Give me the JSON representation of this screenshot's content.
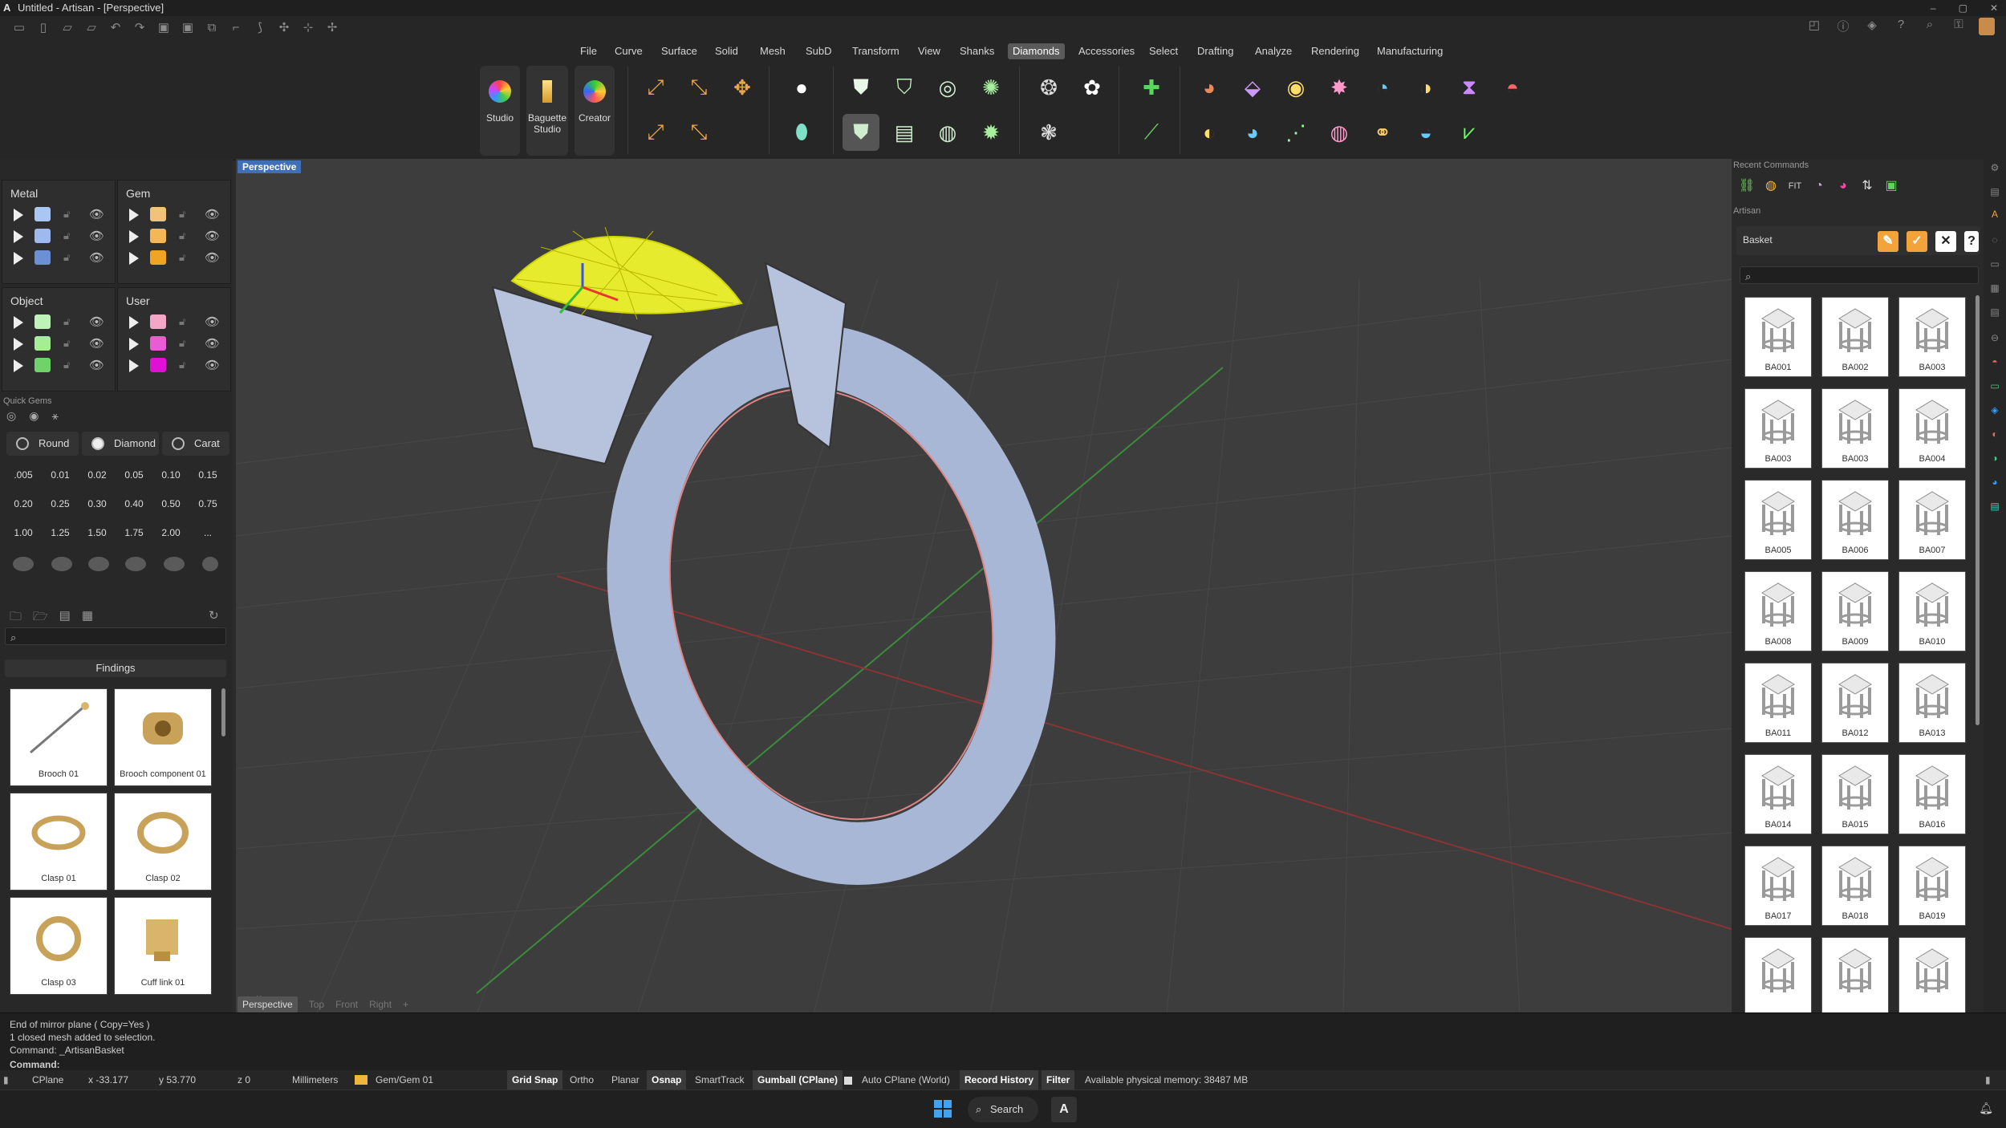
{
  "window": {
    "title": "Untitled - Artisan - [Perspective]",
    "logo": "A",
    "controls": [
      "–",
      "▢",
      "✕"
    ]
  },
  "quick_access": {
    "icons": [
      "new-icon",
      "open-icon",
      "open-icon",
      "open-icon",
      "undo-icon",
      "redo-icon",
      "save-icon",
      "save-as-icon",
      "settings-icon",
      "sketch-icon",
      "polyline-icon",
      "point-icon",
      "dimension-icon",
      "snap-icon"
    ],
    "right_icons": [
      "notification-icon",
      "info-icon",
      "layers-icon",
      "help-icon",
      "search-icon",
      "key-icon"
    ]
  },
  "menu": [
    "File",
    "Curve",
    "Surface",
    "Solid",
    "Mesh",
    "SubD",
    "Transform",
    "View",
    "Shanks",
    "Diamonds",
    "Accessories",
    "Select",
    "Drafting",
    "Analyze",
    "Rendering",
    "Manufacturing"
  ],
  "menu_active": "Diamonds",
  "ribbon": {
    "studio": "Studio",
    "baguette_studio": "Baguette Studio",
    "creator": "Creator"
  },
  "layers": {
    "metal": {
      "title": "Metal",
      "colors": [
        "#a9c7f2",
        "#9eb9ee",
        "#6c8fd6"
      ]
    },
    "gem": {
      "title": "Gem",
      "colors": [
        "#f2c27a",
        "#f3b855",
        "#f0a424"
      ]
    },
    "object": {
      "title": "Object",
      "colors": [
        "#bff2b9",
        "#a6ee94",
        "#6fd36a"
      ]
    },
    "user": {
      "title": "User",
      "colors": [
        "#f3a6c6",
        "#ea5bd4",
        "#e010d4"
      ]
    }
  },
  "quick_gems": {
    "title": "Quick Gems",
    "shape": "Round",
    "material": "Diamond",
    "unit": "Carat",
    "sizes": [
      ".005",
      "0.01",
      "0.02",
      "0.05",
      "0.10",
      "0.15",
      "0.20",
      "0.25",
      "0.30",
      "0.40",
      "0.50",
      "0.75",
      "1.00",
      "1.25",
      "1.50",
      "1.75",
      "2.00",
      "..."
    ]
  },
  "findings": {
    "search_placeholder": "",
    "category": "Findings",
    "items": [
      {
        "label": "Brooch 01",
        "icon": "brooch-pin-icon"
      },
      {
        "label": "Brooch component 01",
        "icon": "brooch-component-icon"
      },
      {
        "label": "Clasp 01",
        "icon": "clasp-icon"
      },
      {
        "label": "Clasp 02",
        "icon": "clasp-icon"
      },
      {
        "label": "Clasp 03",
        "icon": "clasp-icon"
      },
      {
        "label": "Cuff link 01",
        "icon": "cuff-link-icon"
      }
    ]
  },
  "viewport": {
    "active": "Perspective",
    "tabs": [
      "Perspective",
      "Top",
      "Front",
      "Right"
    ],
    "add": "+",
    "axis_y": "y",
    "axis_x": "x"
  },
  "right_panel": {
    "recent_title": "Recent Commands",
    "artisan_title": "Artisan",
    "basket_label": "Basket",
    "search_placeholder": "",
    "basket_items": [
      "BA001",
      "BA002",
      "BA003",
      "BA003",
      "BA003",
      "BA004",
      "BA005",
      "BA006",
      "BA007",
      "BA008",
      "BA009",
      "BA010",
      "BA011",
      "BA012",
      "BA013",
      "BA014",
      "BA015",
      "BA016",
      "BA017",
      "BA018",
      "BA019",
      "",
      "",
      ""
    ]
  },
  "command": {
    "lines": [
      "End of mirror plane ( Copy=Yes )",
      "1 closed mesh added to selection.",
      "Command: _ArtisanBasket"
    ],
    "prompt": "Command:"
  },
  "status": {
    "cplane": "CPlane",
    "x": "x -33.177",
    "y": "y 53.770",
    "z": "z 0",
    "units": "Millimeters",
    "layer": "Gem/Gem 01",
    "grid_snap": "Grid Snap",
    "ortho": "Ortho",
    "planar": "Planar",
    "osnap": "Osnap",
    "smarttrack": "SmartTrack",
    "gumball": "Gumball (CPlane)",
    "auto_cplane": "Auto CPlane (World)",
    "record_history": "Record History",
    "filter": "Filter",
    "memory": "Available physical memory: 38487 MB"
  },
  "taskbar": {
    "search": "Search"
  }
}
